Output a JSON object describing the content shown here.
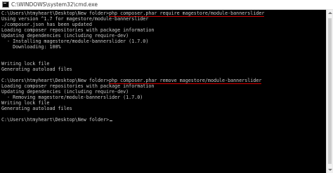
{
  "window": {
    "title": "C:\\WINDOWS\\system32\\cmd.exe",
    "icon": "cmd-icon"
  },
  "console": {
    "lines": [
      {
        "prefix": "C:\\Users\\htmyheart\\Desktop\\New folder>",
        "command": "php composer.phar require magestore/module-bannerslider"
      },
      {
        "text": "Using version ^1.7 for magestore/module-bannerslider"
      },
      {
        "text": "./composer.json has been updated"
      },
      {
        "text": "Loading composer repositories with package information"
      },
      {
        "text": "Updating dependencies (including require-dev)"
      },
      {
        "text": "  - Installing magestore/module-bannerslider (1.7.0)"
      },
      {
        "text": "    Downloading: 100%"
      },
      {
        "text": ""
      },
      {
        "text": ""
      },
      {
        "text": "Writing lock file"
      },
      {
        "text": "Generating autoload files"
      },
      {
        "text": ""
      },
      {
        "prefix": "C:\\Users\\htmyheart\\Desktop\\New folder>",
        "command": "php composer.phar remove magestore/module-bannerslider"
      },
      {
        "text": "Loading composer repositories with package information"
      },
      {
        "text": "Updating dependencies (including require-dev)"
      },
      {
        "text": "  - Removing magestore/module-bannerslider (1.7.0)"
      },
      {
        "text": "Writing lock file"
      },
      {
        "text": "Generating autoload files"
      },
      {
        "text": ""
      },
      {
        "prompt": "C:\\Users\\htmyheart\\Desktop\\New folder>"
      }
    ]
  },
  "colors": {
    "background": "#000000",
    "text": "#c8c8c8",
    "underline": "#d60000",
    "titlebar": "#ffffff"
  }
}
